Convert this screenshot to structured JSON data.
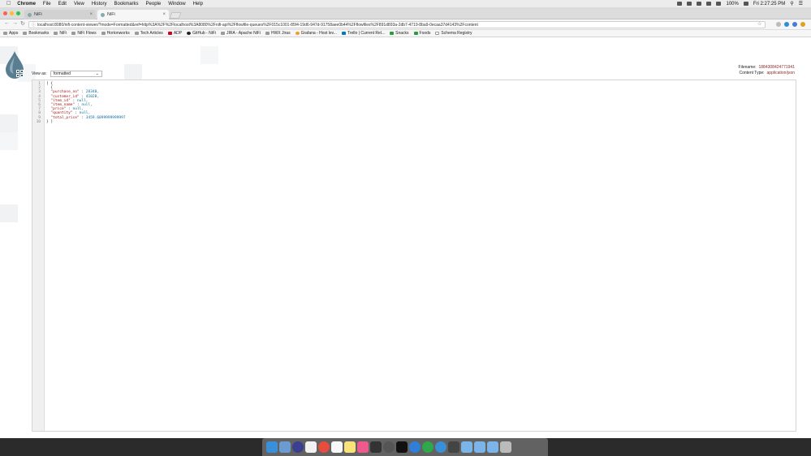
{
  "menubar": {
    "items": [
      "Chrome",
      "File",
      "Edit",
      "View",
      "History",
      "Bookmarks",
      "People",
      "Window",
      "Help"
    ],
    "battery": "100%",
    "clock": "Fri 2:27:25 PM"
  },
  "tabs": [
    {
      "title": "NiFi"
    },
    {
      "title": "NiFi"
    }
  ],
  "url": "localhost:8080/nifi-content-viewer/?mode=Formatted&ref=http%3A%2F%2Flocalhost%3A8080%2Fnifi-api%2Fflowfile-queues%2F015c1001-85f4-19d6-947d-91758aee0b44%2Fflowfiles%2F891d893a-2db7-4719-8ba9-0ecaa37d4143%2Fcontent",
  "bookmarks": [
    "Apps",
    "Bookmarks",
    "NiFi",
    "NiFi Flows",
    "Hortonworks",
    "Tech Articles",
    "ADP",
    "GitHub - NiFi",
    "JIRA - Apache NiFi",
    "HWX Jiras",
    "Grafana - Host lev...",
    "Trello | Current Rel...",
    "Snacks",
    "Foods",
    "Schema Registry"
  ],
  "viewer": {
    "view_as_label": "View as:",
    "view_as_value": "formatted",
    "filename_label": "Filename:",
    "filename_value": "1884308424771941",
    "content_type_label": "Content Type:",
    "content_type_value": "application/json"
  },
  "code_lines": [
    {
      "no": "1",
      "text": "[ {"
    },
    {
      "no": "2",
      "text": "  {"
    },
    {
      "no": "3",
      "text": "  \"purchase_no\" : 28340,"
    },
    {
      "no": "4",
      "text": "  \"customer_id\" : 41028,"
    },
    {
      "no": "5",
      "text": "  \"item_id\" : null,"
    },
    {
      "no": "6",
      "text": "  \"item_name\" : null,"
    },
    {
      "no": "7",
      "text": "  \"price\" : null,"
    },
    {
      "no": "8",
      "text": "  \"quantity\" : null,"
    },
    {
      "no": "9",
      "text": "  \"total_price\" : 3459.6099999999997"
    },
    {
      "no": "10",
      "text": "} ]"
    }
  ],
  "colors": {
    "accent_dark": "#2e5d75",
    "filename_value": "#8a2c2c"
  }
}
